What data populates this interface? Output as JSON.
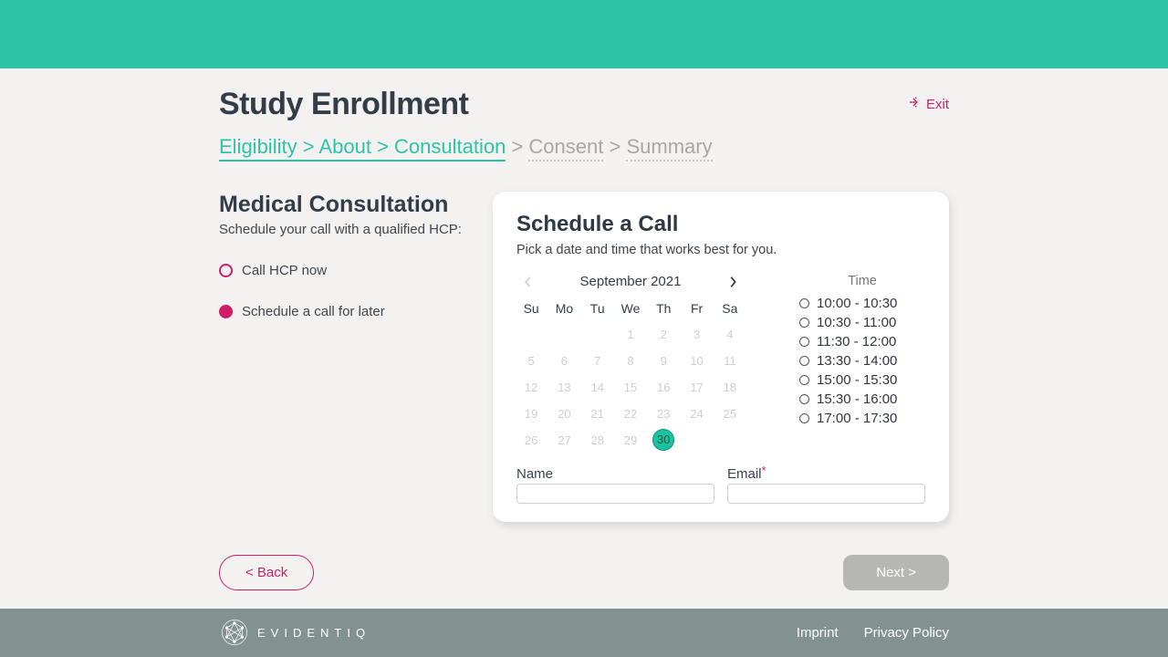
{
  "header": {
    "title": "Study Enrollment",
    "exit": "Exit"
  },
  "breadcrumb": {
    "active": [
      "Eligibility",
      "About",
      "Consultation"
    ],
    "inactive": [
      "Consent",
      "Summary"
    ]
  },
  "section": {
    "title": "Medical Consultation",
    "subtitle": "Schedule your call with a qualified HCP:"
  },
  "options": {
    "now": "Call HCP now",
    "later": "Schedule a call for later"
  },
  "card": {
    "title": "Schedule a Call",
    "subtitle": "Pick a date and time that works best for you."
  },
  "calendar": {
    "month": "September 2021",
    "dow": [
      "Su",
      "Mo",
      "Tu",
      "We",
      "Th",
      "Fr",
      "Sa"
    ],
    "leading_blanks": 3,
    "days": 30,
    "selected": 30
  },
  "time": {
    "label": "Time",
    "slots": [
      "10:00 - 10:30",
      "10:30 - 11:00",
      "11:30 - 12:00",
      "13:30 - 14:00",
      "15:00 - 15:30",
      "15:30 - 16:00",
      "17:00 - 17:30"
    ]
  },
  "form": {
    "name_label": "Name",
    "email_label": "Email"
  },
  "buttons": {
    "back": "< Back",
    "next": "Next >"
  },
  "footer": {
    "brand": "EVIDENTIQ",
    "imprint": "Imprint",
    "privacy": "Privacy Policy"
  }
}
